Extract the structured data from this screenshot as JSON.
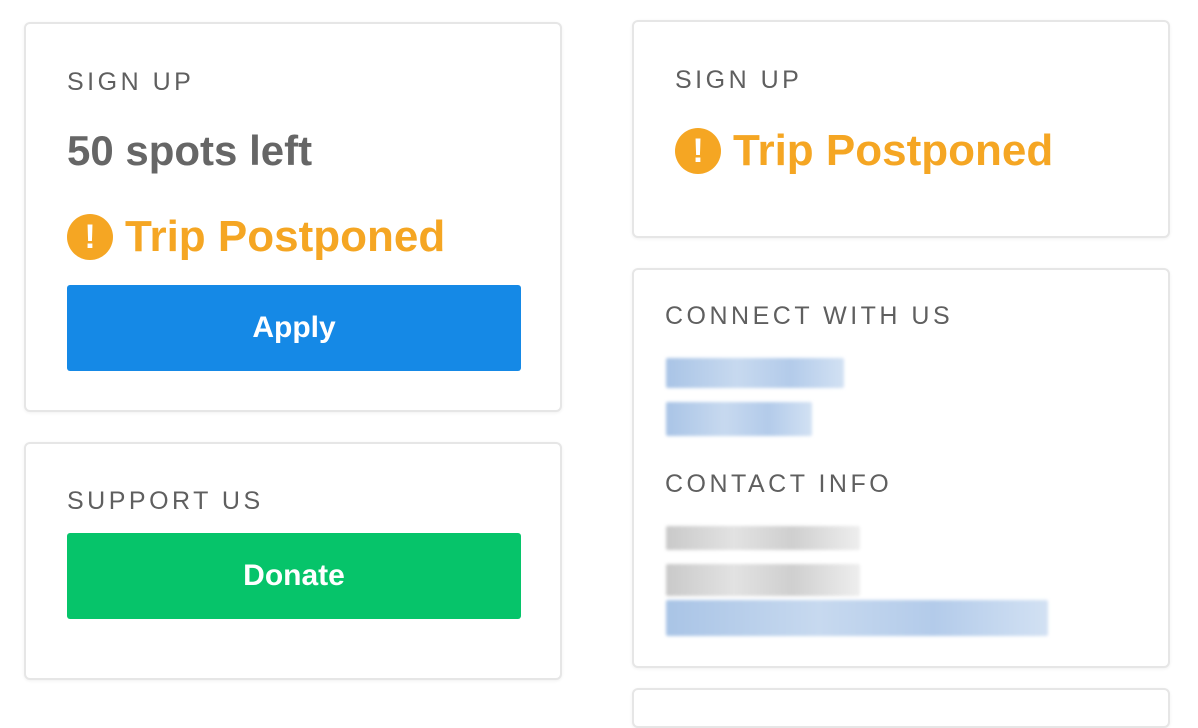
{
  "signup_card_1": {
    "heading": "SIGN UP",
    "spots_left": "50 spots left",
    "status_icon": "exclamation-circle-icon",
    "status_glyph": "!",
    "status_text": "Trip Postponed",
    "apply_label": "Apply"
  },
  "support_card": {
    "heading": "SUPPORT US",
    "donate_label": "Donate"
  },
  "signup_card_2": {
    "heading": "SIGN UP",
    "status_icon": "exclamation-circle-icon",
    "status_glyph": "!",
    "status_text": "Trip Postponed"
  },
  "connect_card": {
    "connect_heading": "CONNECT WITH US",
    "contact_heading": "CONTACT INFO"
  },
  "colors": {
    "warning": "#f5a623",
    "apply_button": "#1589e6",
    "donate_button": "#06c46a",
    "heading_text": "#5f5f5f",
    "spots_text": "#666666",
    "card_border": "#e6e6e6"
  }
}
